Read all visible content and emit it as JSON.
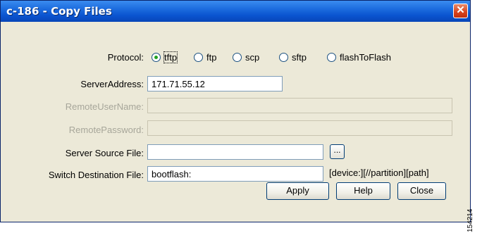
{
  "window": {
    "title": "c-186 - Copy Files",
    "close_symbol": "✕"
  },
  "protocol": {
    "label": "Protocol:",
    "options": [
      "tftp",
      "ftp",
      "scp",
      "sftp",
      "flashToFlash"
    ],
    "selected": "tftp"
  },
  "fields": {
    "server_address": {
      "label": "ServerAddress:",
      "value": "171.71.55.12"
    },
    "remote_user_name": {
      "label": "RemoteUserName:",
      "value": ""
    },
    "remote_password": {
      "label": "RemotePassword:",
      "value": ""
    },
    "server_source_file": {
      "label": "Server Source File:",
      "value": ""
    },
    "switch_destination_file": {
      "label": "Switch Destination File:",
      "value": "bootflash:"
    }
  },
  "browse_button_label": "...",
  "destination_hint": "[device:][//partition][path]",
  "buttons": {
    "apply": "Apply",
    "help": "Help",
    "close": "Close"
  },
  "figure_number": "154214"
}
